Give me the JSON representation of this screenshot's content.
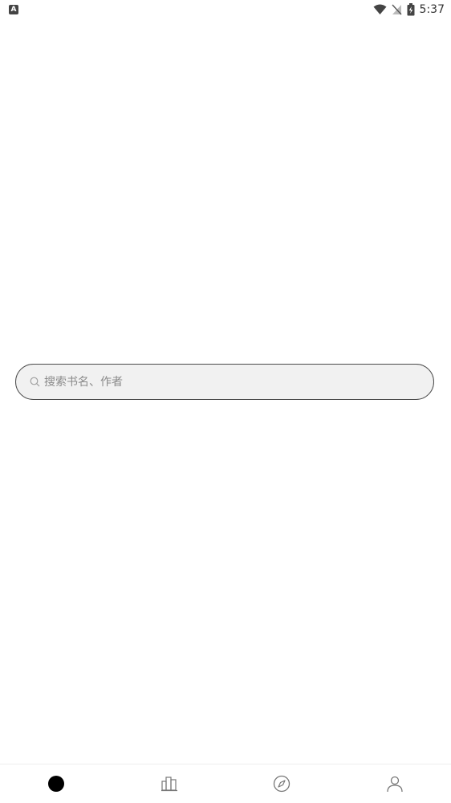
{
  "status_bar": {
    "notification_icon": "a-notification-icon",
    "notification_glyph": "A",
    "wifi_icon": "wifi-icon",
    "signal_icon": "no-signal-icon",
    "battery_icon": "battery-charging-icon",
    "time": "5:37"
  },
  "search": {
    "icon": "search-icon",
    "placeholder": "搜索书名、作者"
  },
  "bottom_nav": {
    "items": [
      {
        "icon": "home-dot-icon",
        "active": true
      },
      {
        "icon": "bookshelf-icon",
        "active": false
      },
      {
        "icon": "compass-icon",
        "active": false
      },
      {
        "icon": "user-icon",
        "active": false
      }
    ]
  },
  "colors": {
    "background": "#ffffff",
    "search_background": "#f1f1f1",
    "search_border": "#4a4a4a",
    "placeholder": "#8a8a8a",
    "active_tab": "#000000",
    "inactive_tab": "#777777"
  }
}
